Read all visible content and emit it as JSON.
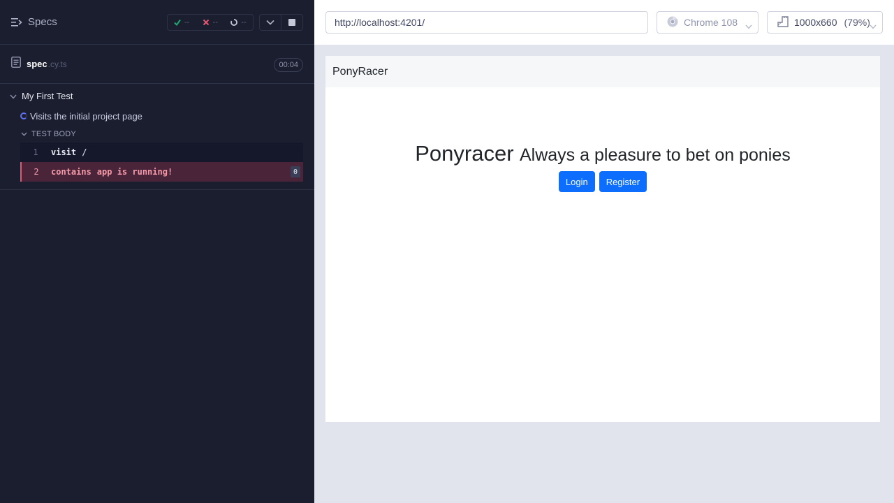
{
  "runner": {
    "specs_label": "Specs",
    "stats": {
      "passed": "--",
      "failed": "--",
      "pending": "--"
    },
    "spec": {
      "name": "spec",
      "ext": ".cy.ts",
      "duration": "00:04"
    },
    "suite": {
      "title": "My First Test"
    },
    "test": {
      "title": "Visits the initial project page"
    },
    "body_label": "TEST BODY",
    "commands": [
      {
        "num": "1",
        "name": "visit",
        "message": "/",
        "state": "passed"
      },
      {
        "num": "2",
        "name": "contains",
        "message": "app is running!",
        "state": "failed",
        "count": "0"
      }
    ]
  },
  "topbar": {
    "url": "http://localhost:4201/",
    "browser": "Chrome 108",
    "viewport": "1000x660",
    "scale": "(79%)"
  },
  "app": {
    "brand": "PonyRacer",
    "title": "Ponyracer",
    "subtitle": "Always a pleasure to bet on ponies",
    "login_label": "Login",
    "register_label": "Register"
  },
  "colors": {
    "runner_bg": "#1b1e2e",
    "failed_row_bg": "#4a2439",
    "failed_text": "#f59aa9",
    "pass_green": "#1fa971",
    "fail_red": "#e45770",
    "primary_button": "#0d6efd"
  }
}
